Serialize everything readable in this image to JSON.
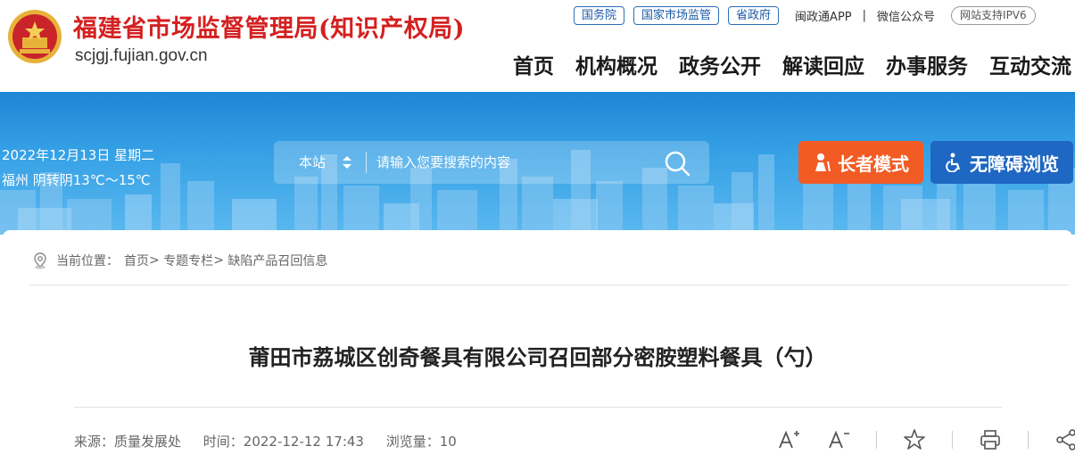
{
  "header": {
    "site_title": "福建省市场监督管理局(知识产权局)",
    "site_domain": "scjgj.fujian.gov.cn",
    "emblem_icon": "national-emblem-icon",
    "top_links": [
      "国务院",
      "国家市场监管",
      "省政府"
    ],
    "app_link": "闽政通APP",
    "wechat_link": "微信公众号",
    "ipv6_badge": "网站支持IPV6",
    "brand_color": "#d42020"
  },
  "nav": {
    "items": [
      "首页",
      "机构概况",
      "政务公开",
      "解读回应",
      "办事服务",
      "互动交流"
    ]
  },
  "banner": {
    "date": "2022年12月13日  星期二",
    "weather": "福州 阴转阴13℃～15℃",
    "search_scope": "本站",
    "search_placeholder": "请输入您要搜索的内容",
    "elder_mode_label": "长者模式",
    "accessibility_label": "无障碍浏览",
    "elder_color": "#f25b23",
    "access_color": "#1e67c2"
  },
  "breadcrumb": {
    "prefix": "当前位置：",
    "items": [
      "首页",
      "专题专栏",
      "缺陷产品召回信息"
    ]
  },
  "article": {
    "title": "莆田市荔城区创奇餐具有限公司召回部分密胺塑料餐具（勺）",
    "source": "来源：质量发展处",
    "time": "时间：2022-12-12 17:43",
    "views": "浏览量：10"
  },
  "tools": [
    "font-increase-icon",
    "font-decrease-icon",
    "star-icon",
    "print-icon",
    "share-icon"
  ]
}
